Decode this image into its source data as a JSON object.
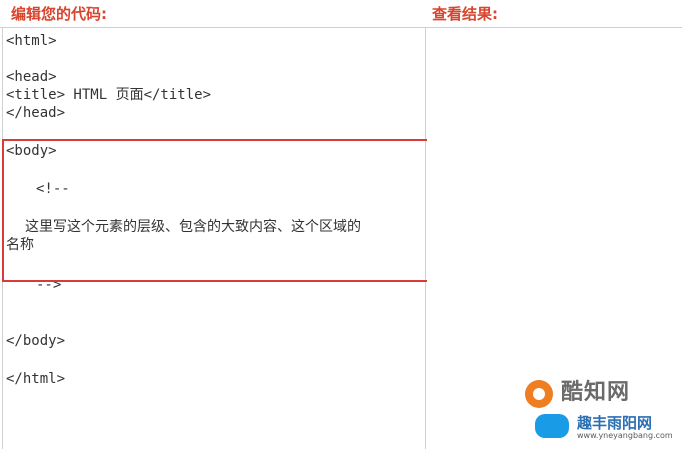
{
  "header": {
    "editor_label": "编辑您的代码:",
    "result_label": "查看结果:"
  },
  "code": {
    "html_open": "<html>",
    "head_open": "<head>",
    "title_line": "<title> HTML 页面</title>",
    "head_close": "</head>",
    "body_open": "<body>",
    "comment_open": "<!--",
    "comment_text_1": "这里写这个元素的层级、包含的大致内容、这个区域的",
    "comment_text_2": "名称",
    "comment_close": "-->",
    "body_close": "</body>",
    "html_close": "</html>"
  },
  "watermark": {
    "logo_text": "酷知网",
    "site_name": "趣丰雨阳网",
    "url": "www.yneyangbang.com"
  },
  "colors": {
    "header_text": "#d8452f",
    "highlight_border": "#d93a3a",
    "code_text": "#333333",
    "watermark_orange": "#ef7d22",
    "watermark_blue": "#1a9be6"
  }
}
